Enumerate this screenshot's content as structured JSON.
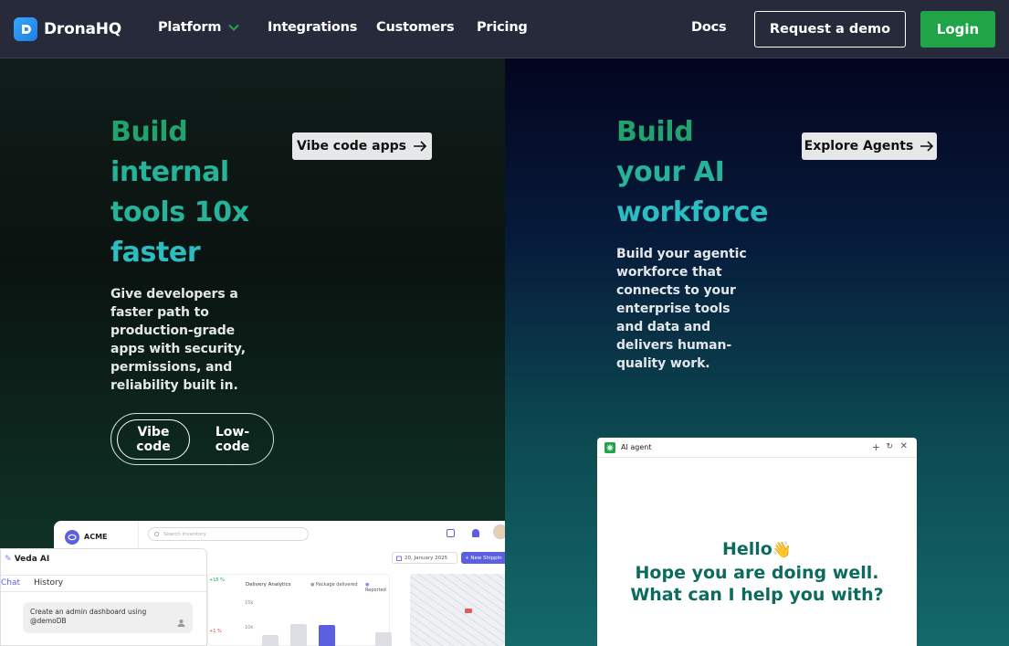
{
  "nav": {
    "brand": "DronaHQ",
    "items": [
      "Platform",
      "Integrations",
      "Customers",
      "Pricing"
    ],
    "docs": "Docs",
    "demo": "Request a demo",
    "login": "Login"
  },
  "left": {
    "title": [
      "Build",
      "internal",
      "tools 10x",
      "faster"
    ],
    "cta": "Vibe code apps",
    "desc": [
      "Give developers a",
      "faster path to",
      "production-grade",
      "apps with security,",
      "permissions, and",
      "reliability built in."
    ],
    "toggle": {
      "active": [
        "Vibe",
        "code"
      ],
      "inactive": [
        "Low-",
        "code"
      ]
    }
  },
  "dashboard": {
    "brand": "ACME",
    "search_placeholder": "Search inventory",
    "date": "20, January 2025",
    "new_button": "+ New Shippin",
    "chart_title": "Delivery Analytics",
    "legend": [
      "Package delivered",
      "Reported"
    ],
    "stat_a": "+15 %",
    "stat_b": "+1 %",
    "y_labels": [
      "15k",
      "10k"
    ]
  },
  "veda": {
    "title": "Veda AI",
    "tabs": [
      "Chat",
      "History"
    ],
    "message": "Create an admin dashboard using @demoDB"
  },
  "right": {
    "title": [
      "Build",
      "your AI",
      "workforce"
    ],
    "cta": "Explore Agents",
    "desc": [
      "Build your agentic",
      "workforce that",
      "connects to your",
      "enterprise tools",
      "and data and",
      "delivers human-",
      "quality work."
    ]
  },
  "agent": {
    "title": "AI agent",
    "greeting": [
      "Hello",
      "Hope you are doing well.",
      "What can I help you with?"
    ],
    "wave": "👋"
  },
  "colors": {
    "login": "#1fa548",
    "nav": "#272a3b",
    "accent_green": "#22a36d",
    "accent_teal": "#2cbdc2"
  }
}
